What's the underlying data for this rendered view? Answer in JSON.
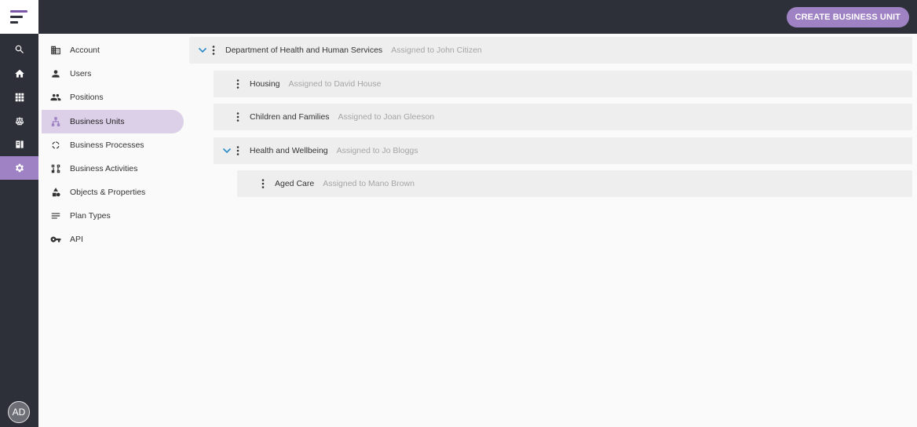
{
  "topbar": {
    "create_button_label": "CREATE BUSINESS UNIT"
  },
  "rail": {
    "items": [
      {
        "icon": "search-icon"
      },
      {
        "icon": "home-icon"
      },
      {
        "icon": "grid-icon"
      },
      {
        "icon": "scales-icon"
      },
      {
        "icon": "book-icon"
      },
      {
        "icon": "gear-icon",
        "active": true
      }
    ],
    "avatar_initials": "AD"
  },
  "settings_nav": {
    "items": [
      {
        "label": "Account",
        "icon": "building-icon"
      },
      {
        "label": "Users",
        "icon": "user-icon"
      },
      {
        "label": "Positions",
        "icon": "people-icon"
      },
      {
        "label": "Business Units",
        "icon": "hierarchy-icon",
        "active": true
      },
      {
        "label": "Business Processes",
        "icon": "cycle-icon"
      },
      {
        "label": "Business Activities",
        "icon": "flow-icon"
      },
      {
        "label": "Objects & Properties",
        "icon": "shapes-icon"
      },
      {
        "label": "Plan Types",
        "icon": "lines-icon"
      },
      {
        "label": "API",
        "icon": "key-icon"
      }
    ]
  },
  "tree": {
    "rows": [
      {
        "name": "Department of Health and Human Services",
        "assigned": "Assigned to John Citizen",
        "expanded": true
      },
      {
        "name": "Housing",
        "assigned": "Assigned to David House"
      },
      {
        "name": "Children and Families",
        "assigned": "Assigned to Joan Gleeson"
      },
      {
        "name": "Health and Wellbeing",
        "assigned": "Assigned to Jo Bloggs",
        "expanded": true
      },
      {
        "name": "Aged Care",
        "assigned": "Assigned to Mano Brown"
      }
    ]
  },
  "colors": {
    "dark": "#2d3039",
    "accent": "#9f82c4",
    "active_nav": "#dccfe8",
    "chevron": "#2b8ac6",
    "row_bg": "#eeeeee"
  }
}
